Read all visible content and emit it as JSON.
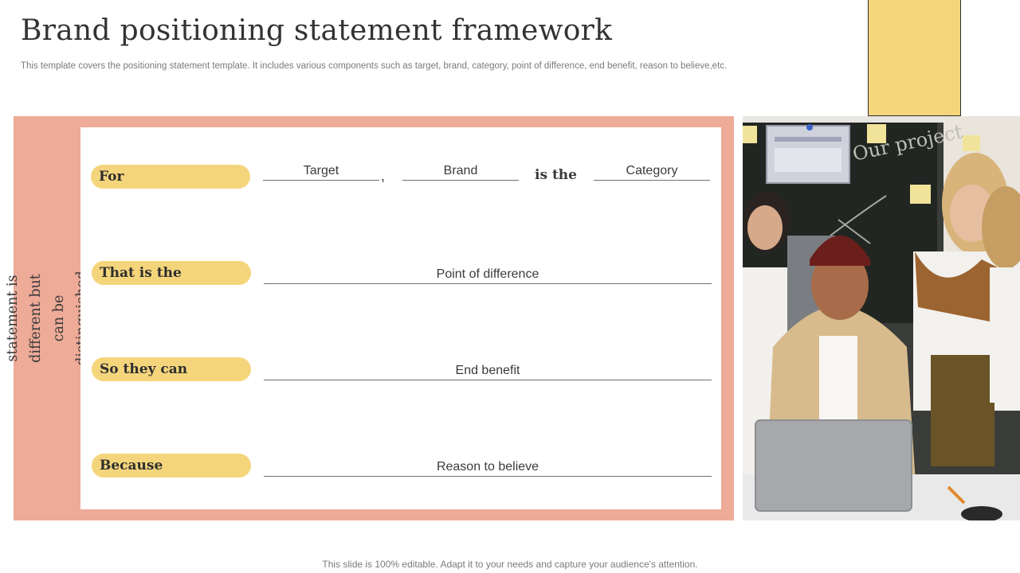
{
  "title": "Brand positioning statement framework",
  "subtitle": "This template covers the positioning statement template. It includes various components such as target, brand, category, point of difference, end benefit, reason to believe,etc.",
  "side_text": "Every positioning statement is different but can be distinguished by a common framework",
  "rows": [
    {
      "label": "For",
      "fields": [
        "Target",
        "Brand",
        "Category"
      ],
      "connector": "is the",
      "comma": ","
    },
    {
      "label": "That is the",
      "fields": [
        "Point of difference"
      ]
    },
    {
      "label": "So they can",
      "fields": [
        "End benefit"
      ]
    },
    {
      "label": "Because",
      "fields": [
        "Reason to believe"
      ]
    }
  ],
  "photo": {
    "board_text": "Our project"
  },
  "footer": "This slide is 100% editable. Adapt it to your needs and capture your audience's attention.",
  "colors": {
    "accent_yellow": "#f5d57c",
    "panel_salmon": "#eeab98",
    "text_dark": "#333333"
  }
}
